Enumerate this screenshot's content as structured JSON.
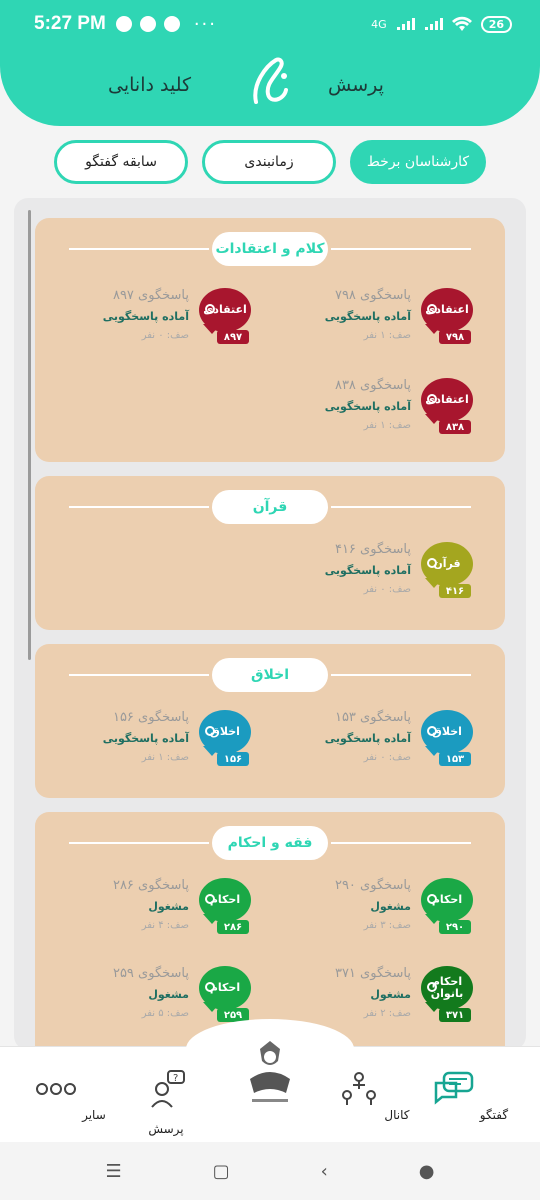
{
  "status_bar": {
    "time": "5:27 PM",
    "network": "4G",
    "battery": "26"
  },
  "header": {
    "nav_left": "کلید دانایی",
    "nav_right": "پرسش"
  },
  "tabs": [
    {
      "label": "سابقه گفتگو",
      "active": false
    },
    {
      "label": "زمانبندی",
      "active": false
    },
    {
      "label": "کارشناسان برخط",
      "active": true
    }
  ],
  "sections": [
    {
      "title": "کلام و اعتقادات",
      "agents": [
        {
          "name": "پاسخگوی ۷۹۸",
          "status": "آماده پاسخگویی",
          "queue": "صف: ۱ نفر",
          "badge": "اعتقادی",
          "number": "۷۹۸",
          "color": "#a8162e"
        },
        {
          "name": "پاسخگوی ۸۹۷",
          "status": "آماده پاسخگویی",
          "queue": "صف: ۰ نفر",
          "badge": "اعتقادی",
          "number": "۸۹۷",
          "color": "#a8162e"
        },
        {
          "name": "پاسخگوی ۸۳۸",
          "status": "آماده پاسخگویی",
          "queue": "صف: ۱ نفر",
          "badge": "اعتقادی",
          "number": "۸۳۸",
          "color": "#a8162e"
        }
      ]
    },
    {
      "title": "قرآن",
      "agents": [
        {
          "name": "پاسخگوی ۴۱۶",
          "status": "آماده پاسخگویی",
          "queue": "صف: ۰ نفر",
          "badge": "قرآن",
          "number": "۴۱۶",
          "color": "#a4a61f"
        }
      ]
    },
    {
      "title": "اخلاق",
      "agents": [
        {
          "name": "پاسخگوی ۱۵۳",
          "status": "آماده پاسخگویی",
          "queue": "صف: ۰ نفر",
          "badge": "اخلاق",
          "number": "۱۵۳",
          "color": "#1b9bc0"
        },
        {
          "name": "پاسخگوی ۱۵۶",
          "status": "آماده پاسخگویی",
          "queue": "صف: ۱ نفر",
          "badge": "اخلاق",
          "number": "۱۵۶",
          "color": "#1b9bc0"
        }
      ]
    },
    {
      "title": "فقه و احکام",
      "agents": [
        {
          "name": "پاسخگوی ۲۹۰",
          "status": "مشغول",
          "queue": "صف: ۳ نفر",
          "badge": "احکام",
          "number": "۲۹۰",
          "color": "#1aa846"
        },
        {
          "name": "پاسخگوی ۲۸۶",
          "status": "مشغول",
          "queue": "صف: ۴ نفر",
          "badge": "احکام",
          "number": "۲۸۶",
          "color": "#1aa846"
        },
        {
          "name": "پاسخگوی ۳۷۱",
          "status": "مشغول",
          "queue": "صف: ۲ نفر",
          "badge": "احکام بانوان",
          "number": "۳۷۱",
          "color": "#137a1d"
        },
        {
          "name": "پاسخگوی ۲۵۹",
          "status": "مشغول",
          "queue": "صف: ۵ نفر",
          "badge": "احکام",
          "number": "۲۵۹",
          "color": "#1aa846"
        }
      ]
    }
  ],
  "bottom_nav": {
    "items": [
      {
        "label": "گفتگو",
        "icon": "chat-icon"
      },
      {
        "label": "کانال",
        "icon": "channel-icon"
      },
      {
        "label": "پرسش",
        "icon": "question-icon"
      },
      {
        "label": "سایر",
        "icon": "more-icon"
      }
    ]
  },
  "colors": {
    "accent": "#2fd6b4",
    "card": "#eccfb0",
    "panel": "#e9e9ea"
  }
}
